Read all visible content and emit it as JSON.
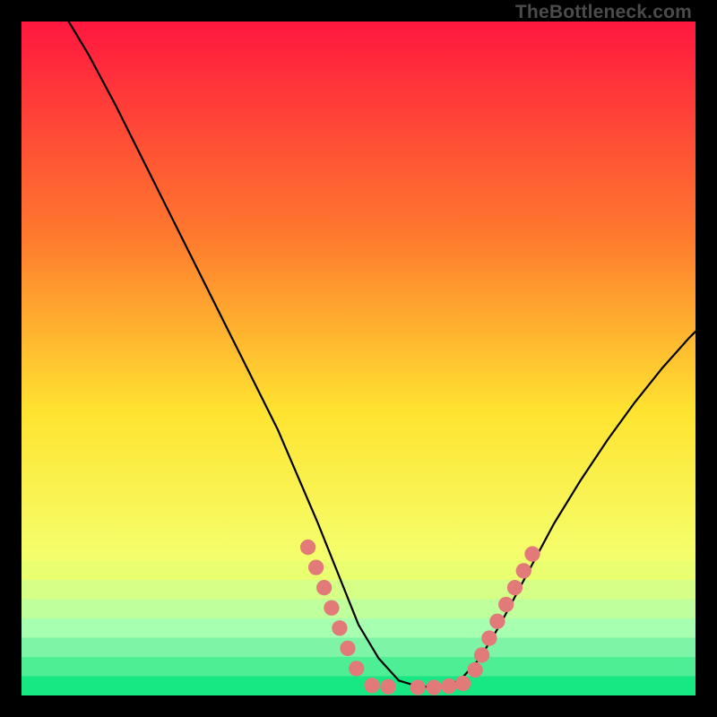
{
  "watermark": "TheBottleneck.com",
  "chart_data": {
    "type": "line",
    "title": "",
    "xlabel": "",
    "ylabel": "",
    "xlim": [
      0,
      100
    ],
    "ylim": [
      0,
      100
    ],
    "background_gradient": {
      "top": "#ff173f",
      "mid_upper": "#ff7a2e",
      "mid": "#ffe430",
      "lower": "#f4ff6e",
      "band1": "#d6ff88",
      "band2": "#a7ffb0",
      "bottom": "#17e884"
    },
    "series": [
      {
        "name": "bottleneck-curve",
        "color": "#000000",
        "x": [
          7,
          10,
          14,
          18,
          22,
          26,
          30,
          34,
          38,
          41,
          44,
          47,
          50,
          53,
          56,
          59,
          62,
          65,
          68,
          71,
          75,
          79,
          83,
          87,
          91,
          95,
          99,
          100
        ],
        "y": [
          100,
          95,
          87.5,
          79.5,
          71.5,
          63.5,
          55.5,
          47.5,
          39.5,
          32.5,
          25.5,
          18,
          10.5,
          5.5,
          2.2,
          1.3,
          1.3,
          2.2,
          5.5,
          10.5,
          18,
          25.5,
          32,
          38,
          43.5,
          48.5,
          53,
          54
        ]
      }
    ],
    "markers": {
      "name": "highlight-dots",
      "color": "#e27a7a",
      "radius_pct": 1.15,
      "points": [
        {
          "x": 42.5,
          "y": 22.0
        },
        {
          "x": 43.7,
          "y": 19.0
        },
        {
          "x": 44.9,
          "y": 16.0
        },
        {
          "x": 46.0,
          "y": 13.0
        },
        {
          "x": 47.2,
          "y": 10.0
        },
        {
          "x": 48.4,
          "y": 7.0
        },
        {
          "x": 49.7,
          "y": 4.0
        },
        {
          "x": 52.0,
          "y": 1.5
        },
        {
          "x": 54.4,
          "y": 1.3
        },
        {
          "x": 58.8,
          "y": 1.2
        },
        {
          "x": 61.2,
          "y": 1.2
        },
        {
          "x": 63.4,
          "y": 1.4
        },
        {
          "x": 65.5,
          "y": 1.8
        },
        {
          "x": 67.3,
          "y": 3.8
        },
        {
          "x": 68.3,
          "y": 6.0
        },
        {
          "x": 69.4,
          "y": 8.5
        },
        {
          "x": 70.6,
          "y": 11.0
        },
        {
          "x": 71.9,
          "y": 13.5
        },
        {
          "x": 73.2,
          "y": 16.0
        },
        {
          "x": 74.5,
          "y": 18.5
        },
        {
          "x": 75.8,
          "y": 21.0
        }
      ]
    }
  }
}
